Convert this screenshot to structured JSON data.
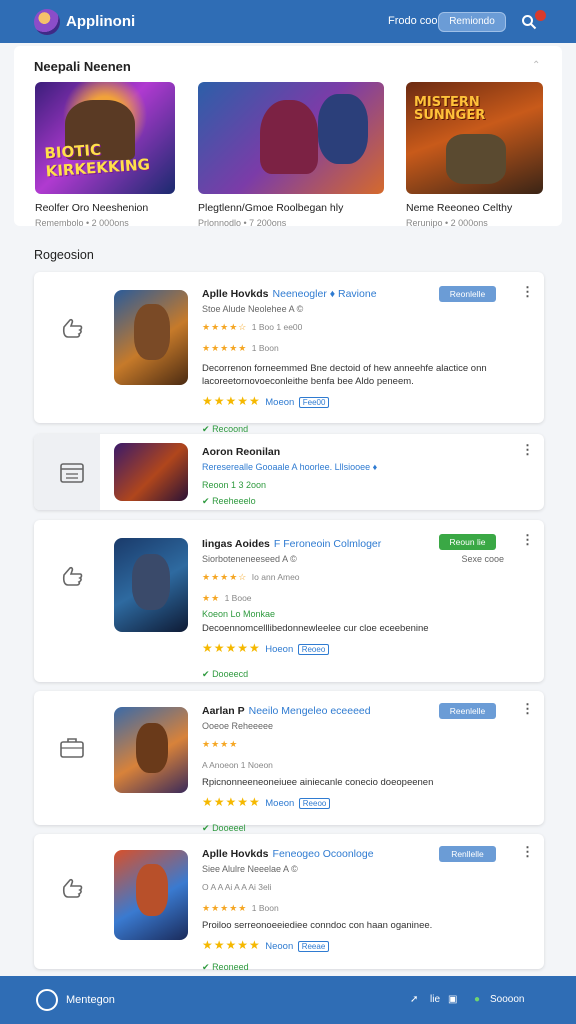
{
  "header": {
    "app_title": "Applinoni",
    "nav_link": "Frodo coo",
    "nav_button": "Remiondo"
  },
  "featured": {
    "title": "Neepali Neenen",
    "items": [
      {
        "name": "Reolfer Oro Neeshenion",
        "meta": "Remembolo  •  2 000ons",
        "art": "BIOTIC KIRKEKKING"
      },
      {
        "name": "Plegtlenn/Gmoe Roolbegan hly",
        "meta": "Prlonnodlo  •  7 200ons",
        "art": ""
      },
      {
        "name": "Neme Reeoneo Celthy",
        "meta": "Rerunipo  •  2 000ons",
        "art": "MISTERN SUNNGER"
      }
    ]
  },
  "list_title": "Rogeosion",
  "apps": [
    {
      "name": "Aplle Hovkds",
      "vendor": "Neeneogler ♦ Ravione",
      "sub": "Stoe Alude Neolehee A ©",
      "rating_text": "1 Boo 1 ee00",
      "rating2": "1 Boon",
      "desc": "Decorrenon forneemmed Bne dectoid of hew anneehfe alactice onn lacoreetornovoeconleithe benfa bee Aldo peneem.",
      "reviews": "Moeon",
      "chip": "Fee00",
      "status": "Recoond",
      "button": "Reonlelle"
    },
    {
      "name": "Aoron Reonilan",
      "vendor": "",
      "sub": "Rereserealle Gooaale A hoorlee. Lllsiooee ♦",
      "rating_text": "Reoon  1 3 2oon",
      "status": "Reeheeelo"
    },
    {
      "name": "Iingas Aoides",
      "vendor": "F Feroneoin Colmloger",
      "sub": "Siorboteneneeseed A ©",
      "right_meta": "Sexe cooe",
      "rating_text": "Io ann Ameo",
      "rating2": "1 Booe",
      "extra": "Koeon Lo Monkae",
      "desc": "Decoennomcelllibedonnewleelee cur cloe eceebenine",
      "reviews": "Hoeon",
      "chip": "Reoeo",
      "status": "Dooeecd",
      "button": "Reoun lie"
    },
    {
      "name": "Aarlan P",
      "vendor": "Neeilo Mengeleo eceeeed",
      "sub": "Ooeoe  Reheeeee",
      "rating_text": "A Anoeon  1 Noeon",
      "desc": "Rpicnonneeneoneiuee ainiecanle conecio doeopeenen",
      "reviews": "Moeon",
      "chip": "Reeoo",
      "status": "Dooeeel",
      "button": "Reenlelle"
    },
    {
      "name": "Aplle Hovkds",
      "vendor": "Feneogeo Ocoonloge",
      "sub": "Siee Alulre Neeelae A ©",
      "rating_text": "O A  A Ai  A A  Ai 3eli",
      "rating2": "1 Boon",
      "desc": "Proiloo serreonoeeiediee conndoc con haan oganinee.",
      "reviews": "Neoon",
      "chip": "Reeae",
      "status": "Reoneed",
      "button": "Renllelle"
    }
  ],
  "footer": {
    "label": "Mentegon",
    "count_a": "lie",
    "count_b": "Soooon"
  },
  "colors": {
    "brand": "#2f6db5",
    "accent_green": "#3aa845",
    "link": "#2f7bd1",
    "star": "#f5b800"
  },
  "icons": [
    "search-icon",
    "notification-badge",
    "chevron-up-icon",
    "thumbs-up-icon",
    "calendar-icon",
    "briefcase-icon",
    "more-vertical-icon",
    "compass-icon",
    "share-icon",
    "message-icon"
  ]
}
